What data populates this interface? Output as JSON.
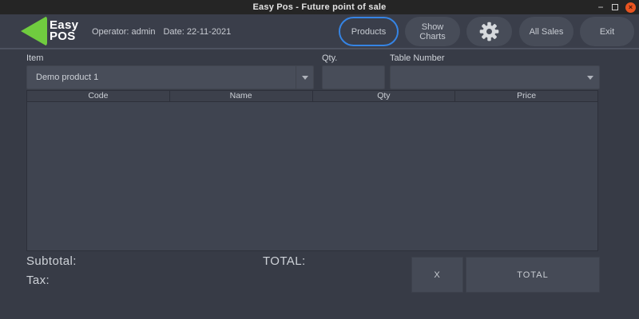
{
  "window": {
    "title": "Easy Pos - Future point of sale",
    "controls": {
      "minimize": "−",
      "close": "×"
    }
  },
  "header": {
    "logo": {
      "line1": "Easy",
      "line2": "POS"
    },
    "operator": "Operator: admin",
    "date": "Date: 22-11-2021",
    "buttons": {
      "products": "Products",
      "show_charts": "Show Charts",
      "settings_icon": "gear",
      "all_sales": "All Sales",
      "exit": "Exit"
    }
  },
  "form": {
    "item_label": "Item",
    "item_value": "Demo product 1",
    "qty_label": "Qty.",
    "qty_value": "",
    "table_number_label": "Table Number",
    "table_number_value": ""
  },
  "table": {
    "columns": [
      "Code",
      "Name",
      "Qty",
      "Price"
    ],
    "rows": []
  },
  "totals": {
    "subtotal_label": "Subtotal:",
    "subtotal_value": "",
    "tax_label": "Tax:",
    "tax_value": "",
    "total_label": "TOTAL:",
    "total_value": ""
  },
  "actions": {
    "clear": "X",
    "total": "TOTAL"
  },
  "colors": {
    "accent_blue": "#3584e4",
    "logo_green": "#70cc3f",
    "close_red": "#e95420",
    "header_bg": "#3a3e4a",
    "main_bg": "#373b46",
    "field_bg": "#484d59",
    "table_body_bg": "#3f4450"
  }
}
